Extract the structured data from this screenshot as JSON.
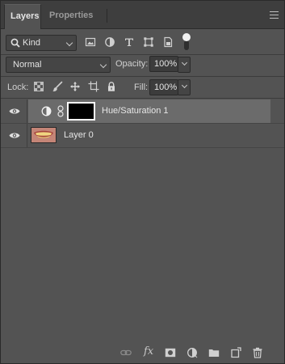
{
  "tabs": [
    {
      "label": "Layers",
      "active": true
    },
    {
      "label": "Properties",
      "active": false
    }
  ],
  "filter": {
    "kind_label": "Kind",
    "icons": [
      "pixel-filter-icon",
      "adjustment-filter-icon",
      "type-filter-icon",
      "shape-filter-icon",
      "smart-object-filter-icon"
    ]
  },
  "blend": {
    "mode": "Normal",
    "opacity_label": "Opacity:",
    "opacity_value": "100%"
  },
  "lock": {
    "label": "Lock:",
    "icons": [
      "lock-transparent-pixels-icon",
      "lock-image-pixels-icon",
      "lock-position-icon",
      "lock-artboard-icon",
      "lock-all-icon"
    ],
    "fill_label": "Fill:",
    "fill_value": "100%"
  },
  "layers": [
    {
      "name": "Hue/Saturation 1",
      "type": "adjustment",
      "visible": true,
      "selected": true
    },
    {
      "name": "Layer 0",
      "type": "pixel",
      "visible": true,
      "selected": false
    }
  ],
  "bottom_toolbar": [
    "link-layers-icon",
    "fx-icon",
    "add-mask-icon",
    "adjustment-layer-icon",
    "group-folder-icon",
    "new-layer-icon",
    "trash-icon"
  ],
  "colors": {
    "panel_bg": "#535353",
    "tabbar_bg": "#3e3e3e",
    "selected_layer": "#6b6b6b"
  }
}
